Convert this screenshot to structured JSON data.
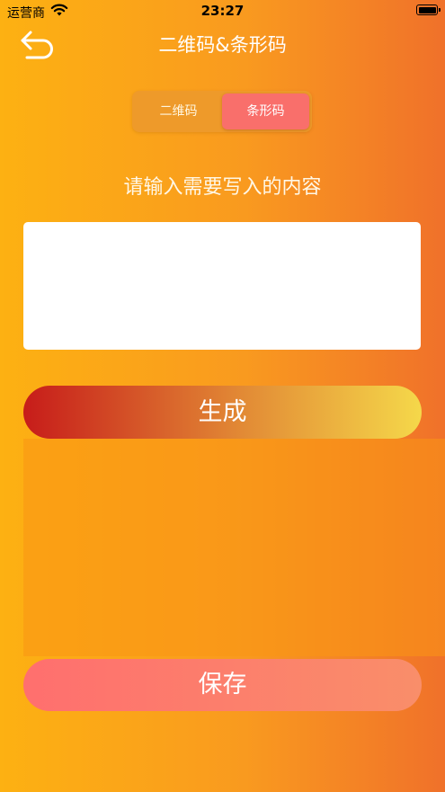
{
  "status_bar": {
    "carrier": "运营商",
    "time": "23:27"
  },
  "nav": {
    "title": "二维码&条形码",
    "back_icon": "back-arrow-icon"
  },
  "segments": [
    {
      "label": "二维码",
      "selected": false
    },
    {
      "label": "条形码",
      "selected": true
    }
  ],
  "prompt": "请输入需要写入的内容",
  "input": {
    "value": ""
  },
  "generate_label": "生成",
  "save_label": "保存",
  "colors": {
    "background_left": "#fdb112",
    "background_right": "#f0712a",
    "segment_selected": "#f96f6b",
    "generate_gradient": [
      "#c71c1a",
      "#e28a35",
      "#f5d84a"
    ],
    "save_gradient": [
      "#ff6f6e",
      "#f98e6a"
    ]
  }
}
